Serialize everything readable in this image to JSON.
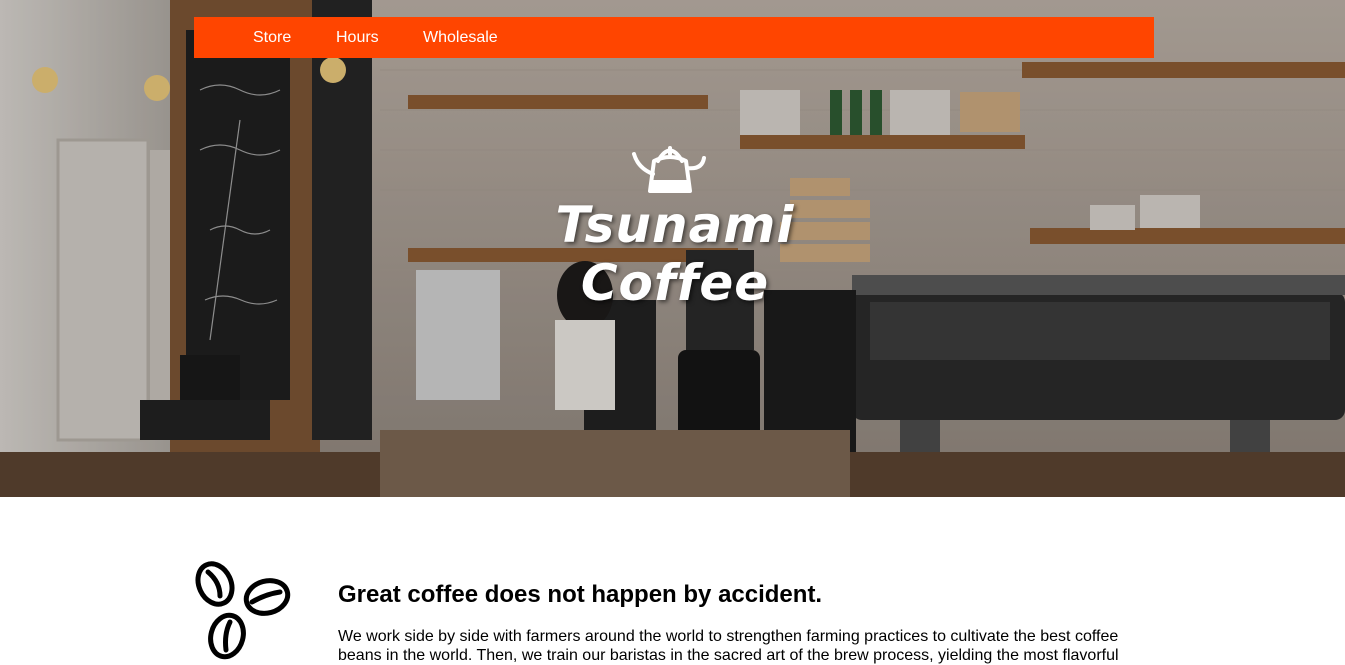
{
  "nav": {
    "items": [
      {
        "label": "Store"
      },
      {
        "label": "Hours"
      },
      {
        "label": "Wholesale"
      }
    ],
    "background": "#ff4500"
  },
  "hero": {
    "logo_line1": "Tsunami",
    "logo_line2": "Coffee",
    "logo_icon": "kettle-icon"
  },
  "section": {
    "icon": "coffee-beans-icon",
    "title": "Great coffee does not happen by accident.",
    "body": "We work side by side with farmers around the world to strengthen farming practices to cultivate the best coffee beans in the world. Then, we train our baristas in the sacred art of the brew process, yielding the most flavorful"
  }
}
